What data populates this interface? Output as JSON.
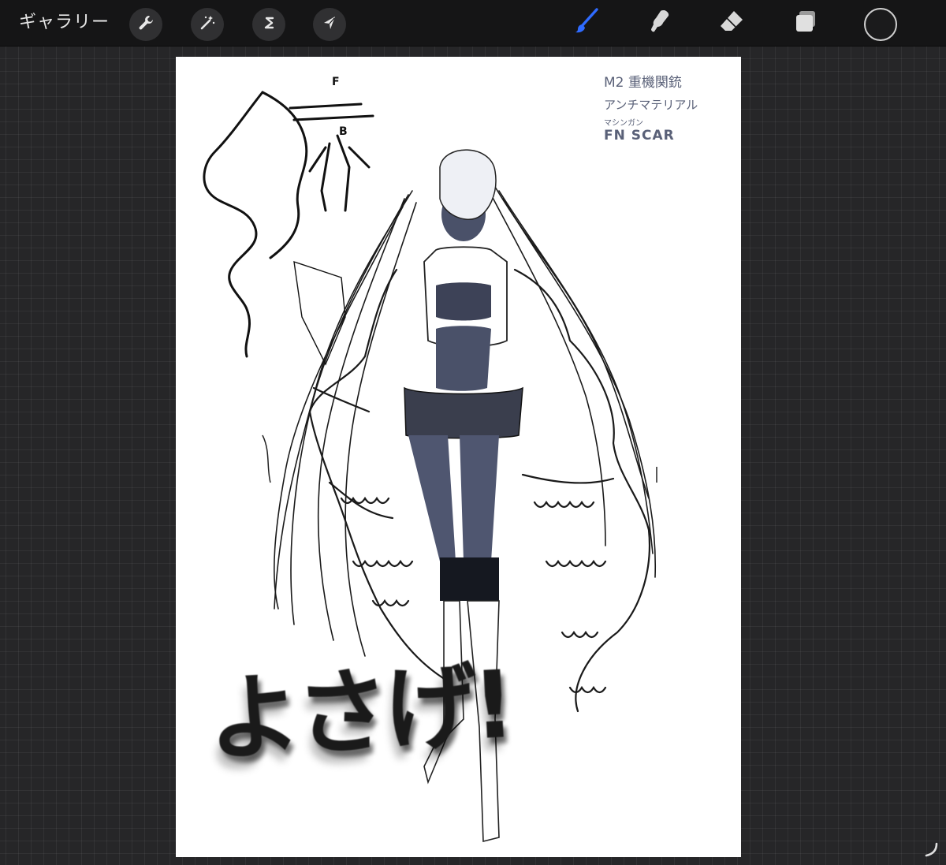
{
  "toolbar": {
    "gallery_label": "ギャラリー",
    "left_tools": [
      {
        "name": "wrench-icon",
        "label": "actions"
      },
      {
        "name": "magic-wand-icon",
        "label": "adjustments"
      },
      {
        "name": "selection-s-icon",
        "label": "selection"
      },
      {
        "name": "transform-arrow-icon",
        "label": "transform"
      }
    ],
    "right_tools": [
      {
        "name": "brush-icon",
        "label": "paint",
        "active": true
      },
      {
        "name": "smudge-icon",
        "label": "smudge"
      },
      {
        "name": "eraser-icon",
        "label": "erase"
      },
      {
        "name": "layers-icon",
        "label": "layers"
      }
    ],
    "current_color": "#1b1b1c",
    "active_color": "#2f6bff"
  },
  "canvas": {
    "notes": {
      "line1": "M2 重機関銃",
      "line2": "アンチマテリアル",
      "line3": "マシンガン",
      "line4": "FN SCAR"
    },
    "sketch_labels": {
      "front": "F",
      "back": "B"
    },
    "big_text": "よさげ!"
  },
  "colors": {
    "toolbar_bg": "#151516",
    "workspace_bg": "#262628",
    "skin_tone": "#4a5169",
    "ink": "#111111"
  }
}
